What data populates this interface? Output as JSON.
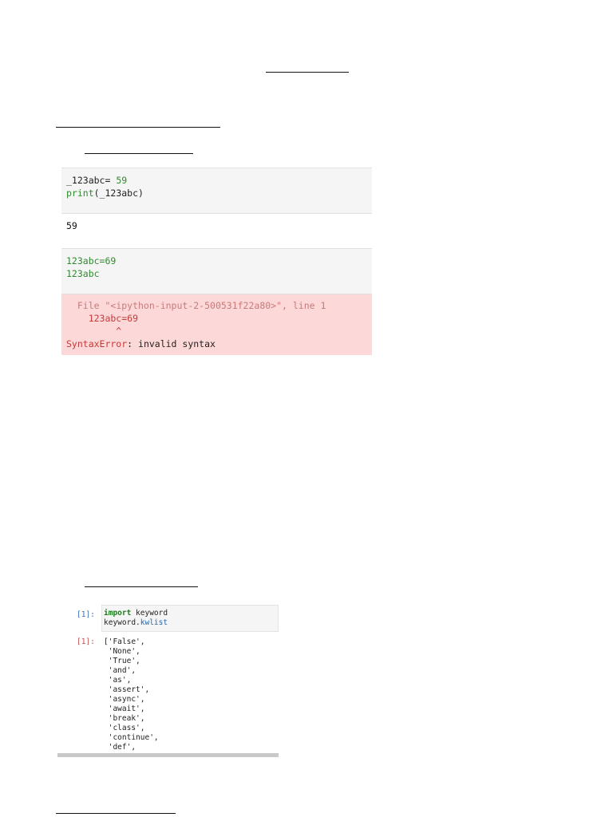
{
  "cell1": {
    "line1_var": "_123abc=",
    "line1_val": " 59",
    "line2_func": "print",
    "line2_args": "(_123abc)",
    "output": "59"
  },
  "cell2": {
    "line1": "123abc=69",
    "line2": "123abc",
    "error": {
      "file_prefix": "  File ",
      "file_path": "\"<ipython-input-2-500531f22a80>\"",
      "file_suffix": ", line 1",
      "code_line": "    123abc=69",
      "caret": "         ^",
      "error_name": "SyntaxError",
      "error_msg": ": invalid syntax"
    }
  },
  "cell3": {
    "in_prompt": "[1]:",
    "line1_kw": "import",
    "line1_rest": " keyword",
    "line2_obj": "keyword.",
    "line2_attr": "kwlist",
    "out_prompt": "[1]:",
    "out_items": [
      "['False',",
      " 'None',",
      " 'True',",
      " 'and',",
      " 'as',",
      " 'assert',",
      " 'async',",
      " 'await',",
      " 'break',",
      " 'class',",
      " 'continue',",
      " 'def',"
    ]
  }
}
